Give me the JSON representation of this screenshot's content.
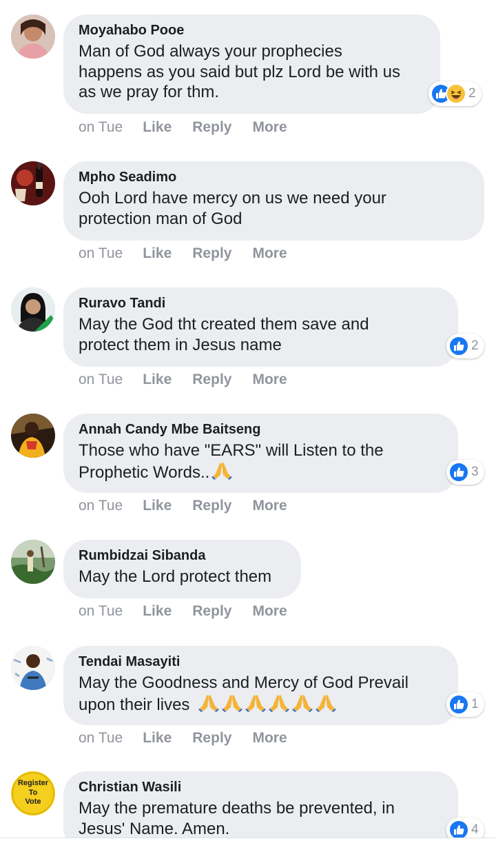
{
  "comments": [
    {
      "author": "Moyahabo Pooe",
      "text": "Man of God always your prophecies\nhappens as you said but plz Lord be with us\nas we pray for thm.",
      "reaction_count": "2",
      "reaction_icons": [
        "like-icon",
        "haha-icon"
      ],
      "time": "on Tue",
      "actions": [
        "Like",
        "Reply",
        "More"
      ]
    },
    {
      "author": "Mpho Seadimo",
      "text": "Ooh Lord have mercy on us we need your\nprotection man of God",
      "time": "on Tue",
      "actions": [
        "Like",
        "Reply",
        "More"
      ]
    },
    {
      "author": "Ruravo Tandi",
      "text": "May the God tht created them save and\nprotect them in Jesus name",
      "reaction_count": "2",
      "reaction_icons": [
        "like-icon"
      ],
      "time": "on Tue",
      "actions": [
        "Like",
        "Reply",
        "More"
      ]
    },
    {
      "author": "Annah Candy Mbe Baitseng",
      "text_line1": "Those who have \"EARS\" will Listen to the",
      "text_line2": "Prophetic Words..",
      "emoji": "folded-hands-icon",
      "reaction_count": "3",
      "reaction_icons": [
        "like-icon"
      ],
      "time": "on Tue",
      "actions": [
        "Like",
        "Reply",
        "More"
      ]
    },
    {
      "author": "Rumbidzai Sibanda",
      "text": "May the Lord protect them",
      "time": "on Tue",
      "actions": [
        "Like",
        "Reply",
        "More"
      ]
    },
    {
      "author": "Tendai Masayiti",
      "text_line1": "May the Goodness and Mercy of God Prevail",
      "text_line2": "upon their lives ",
      "emoji": "folded-hands-icon",
      "emoji_count": 6,
      "reaction_count": "1",
      "reaction_icons": [
        "like-icon"
      ],
      "time": "on Tue",
      "actions": [
        "Like",
        "Reply",
        "More"
      ]
    },
    {
      "author": "Christian Wasili",
      "avatar_text": [
        "Register",
        "To",
        "Vote"
      ],
      "text": "May the premature deaths be prevented, in\nJesus' Name. Amen.",
      "reaction_count": "4",
      "reaction_icons": [
        "like-icon"
      ]
    }
  ],
  "colors": {
    "bubble": "#ebedf0",
    "meta_text": "#90949c",
    "like_blue": "#1877f2",
    "haha_yellow": "#f7c33a"
  }
}
